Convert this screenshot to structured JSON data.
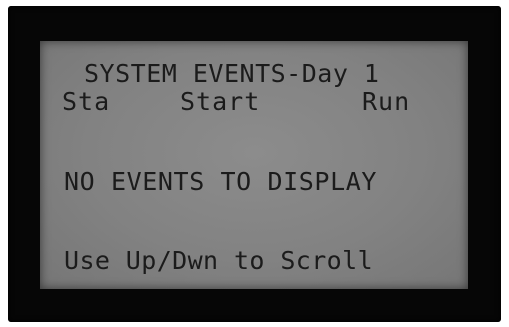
{
  "screen": {
    "title": "SYSTEM EVENTS-Day 1",
    "columns": [
      "Sta",
      "Start",
      "Run"
    ],
    "message": "NO EVENTS TO DISPLAY",
    "hint": "Use Up/Dwn to Scroll"
  },
  "colors": {
    "bezel": "#060606",
    "lcd_background": "#858585",
    "lcd_text": "#1b1b1b"
  }
}
